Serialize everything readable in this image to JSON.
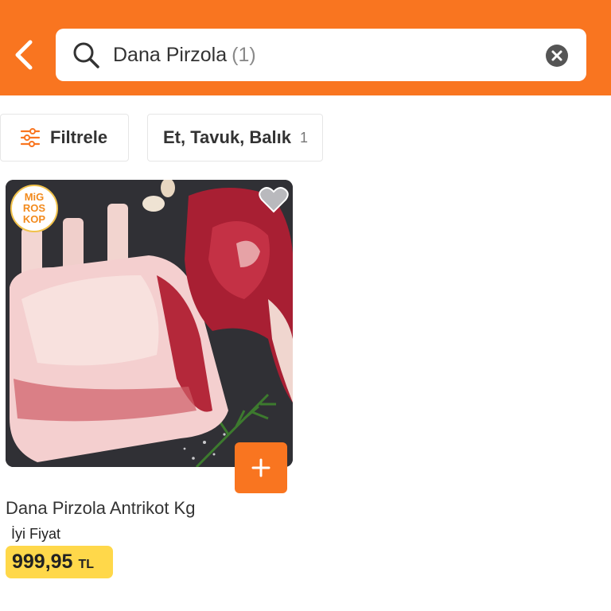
{
  "header": {
    "back_icon": "chevron-left-icon",
    "search": {
      "query": "Dana Pirzola",
      "result_count": "(1)",
      "search_icon": "search-icon",
      "clear_icon": "clear-icon"
    }
  },
  "filters": {
    "filter_label": "Filtrele",
    "filter_icon": "sliders-icon",
    "category_chip": {
      "label": "Et, Tavuk, Balık",
      "count": "1"
    }
  },
  "products": [
    {
      "name": "Dana Pirzola Antrikot Kg",
      "tag": "İyi Fiyat",
      "price": "999,95",
      "currency": "TL",
      "badge_lines": [
        "MiG",
        "ROS",
        "KOP"
      ],
      "favorite_icon": "heart-icon",
      "add_icon": "plus-icon"
    }
  ],
  "colors": {
    "accent": "#f97520",
    "price_highlight": "#ffd84a"
  }
}
